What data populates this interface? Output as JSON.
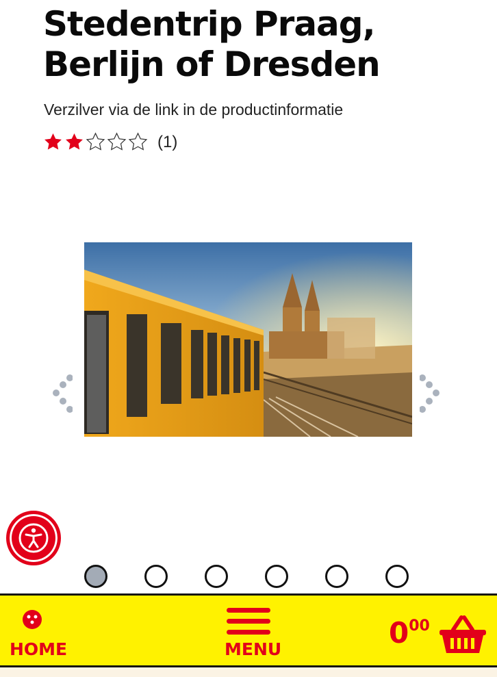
{
  "product": {
    "title_line1": "Stedentrip Praag,",
    "title_line2": "Berlijn of Dresden",
    "subtitle": "Verzilver via de link in de productinformatie",
    "rating": {
      "value": 2,
      "max": 5,
      "count_label": "(1)"
    }
  },
  "gallery": {
    "total_images": 6,
    "active_index": 0,
    "image_description": "yellow train passing a bridge with towers at sunset"
  },
  "bottom_nav": {
    "home_label": "HOME",
    "menu_label": "MENU",
    "cart_price_main": "0",
    "cart_price_cents": "00"
  },
  "colors": {
    "brand_red": "#e2001a",
    "brand_yellow": "#fff200",
    "dot_active": "#a3abb6"
  },
  "icons": [
    "star-filled-icon",
    "star-empty-icon",
    "chevron-left-icon",
    "chevron-right-icon",
    "accessibility-icon",
    "home-dice-icon",
    "hamburger-menu-icon",
    "basket-icon"
  ]
}
